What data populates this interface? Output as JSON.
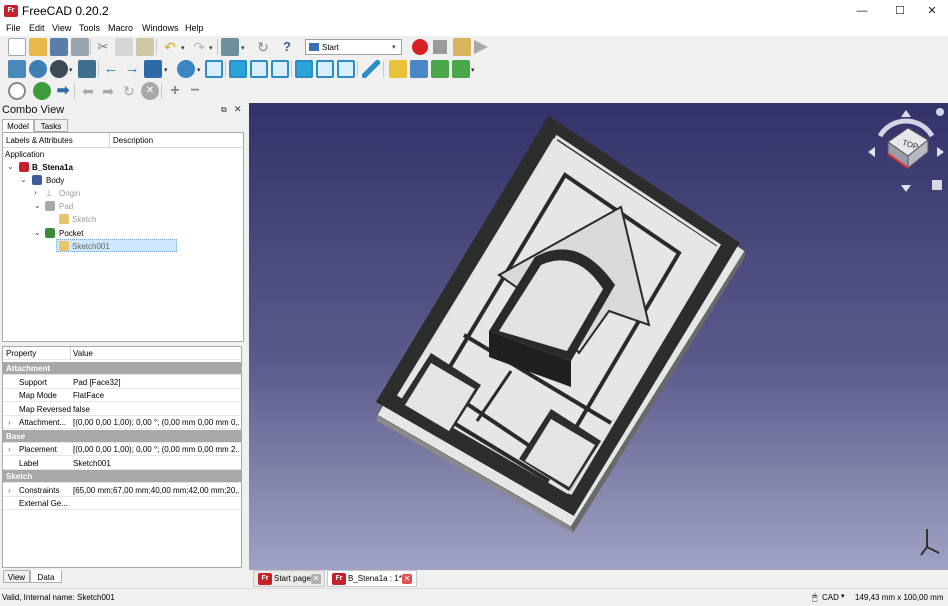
{
  "window": {
    "title": "FreeCAD 0.20.2",
    "app_badge": "Fr",
    "min": "—",
    "max": "☐",
    "close": "✕"
  },
  "menu": [
    "File",
    "Edit",
    "View",
    "Tools",
    "Macro",
    "Windows",
    "Help"
  ],
  "workbench": {
    "selected": "Start"
  },
  "combo": {
    "title": "Combo View",
    "tabs": {
      "model": "Model",
      "tasks": "Tasks"
    },
    "bottom_tabs": {
      "view": "View",
      "data": "Data"
    }
  },
  "tree": {
    "header": {
      "col1": "Labels & Attributes",
      "col2": "Description"
    },
    "root": "Application",
    "doc": "B_Stena1a",
    "body": "Body",
    "origin": "Origin",
    "pad": "Pad",
    "sketch": "Sketch",
    "pocket": "Pocket",
    "sketch001": "Sketch001"
  },
  "props": {
    "header": {
      "property": "Property",
      "value": "Value"
    },
    "groups": [
      {
        "name": "Attachment",
        "rows": [
          {
            "name": "Support",
            "value": "Pad [Face32]"
          },
          {
            "name": "Map Mode",
            "value": "FlatFace"
          },
          {
            "name": "Map Reversed",
            "value": "false"
          },
          {
            "name": "Attachment...",
            "value": "[(0,00 0,00 1,00); 0,00 °; (0,00 mm  0,00 mm  0,..."
          }
        ]
      },
      {
        "name": "Base",
        "rows": [
          {
            "name": "Placement",
            "value": "[(0,00 0,00 1,00); 0,00 °; (0,00 mm  0,00 mm  2..."
          },
          {
            "name": "Label",
            "value": "Sketch001"
          }
        ]
      },
      {
        "name": "Sketch",
        "rows": [
          {
            "name": "Constraints",
            "value": "[65,00 mm;67,00 mm;40,00 mm;42,00 mm;20,..."
          },
          {
            "name": "External Ge...",
            "value": ""
          }
        ]
      }
    ]
  },
  "navcube": {
    "face": "TOP"
  },
  "doctabs": [
    {
      "label": "Start page"
    },
    {
      "label": "B_Stena1a : 1*"
    }
  ],
  "status": {
    "left": "Valid, Internal name: Sketch001",
    "nav": "CAD",
    "dims": "149,43 mm x 100,00 mm"
  },
  "colors": {
    "viewport_top": "#33336a",
    "viewport_bottom": "#a0a3c4",
    "selection": "#cde8ff",
    "record": "#d91f26"
  }
}
